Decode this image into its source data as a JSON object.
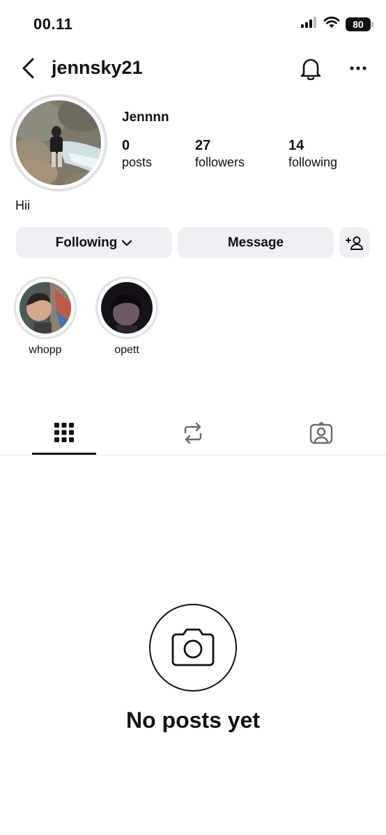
{
  "status_bar": {
    "time": "00.11",
    "battery": "80"
  },
  "header": {
    "username": "jennsky21"
  },
  "profile": {
    "display_name": "Jennnn",
    "stats": [
      {
        "value": "0",
        "label": "posts"
      },
      {
        "value": "27",
        "label": "followers"
      },
      {
        "value": "14",
        "label": "following"
      }
    ],
    "bio": "Hii"
  },
  "actions": {
    "following_label": "Following",
    "message_label": "Message"
  },
  "highlights": [
    {
      "label": "whopp"
    },
    {
      "label": "opett"
    }
  ],
  "tabs": [
    "grid-icon",
    "repost-icon",
    "tagged-icon"
  ],
  "empty_state": {
    "title": "No posts yet",
    "icon": "camera-icon"
  }
}
